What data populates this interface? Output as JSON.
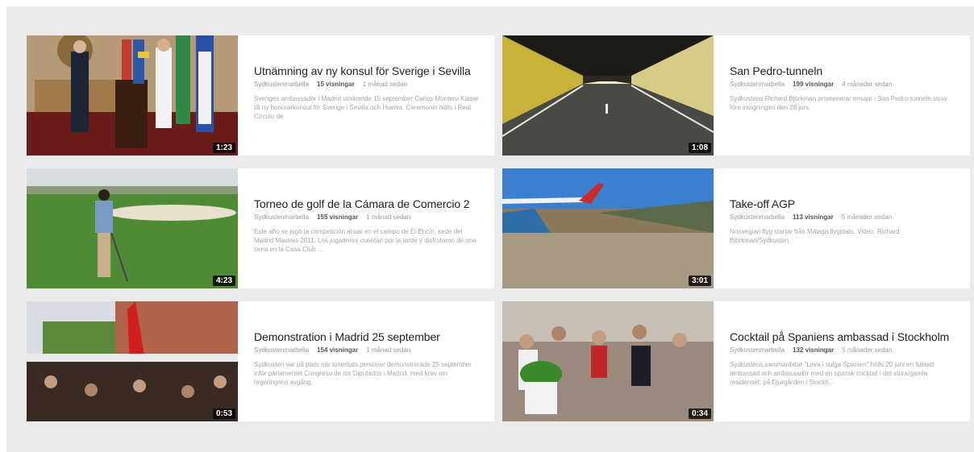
{
  "videos": [
    {
      "title": "Utnämning av ny konsul för Sverige i Sevilla",
      "channel": "Sydkustenmarbella",
      "views": "15 visningar",
      "age": "1 månad sedan",
      "description": "Sveriges ambassadör i Madrid utnämnde 15 september Carlos Montero Kaiser till ny honorärkonsul för Sverige i Sevilla och Huelva. Ceremonin hölls i Real Círculo de",
      "duration": "1:23"
    },
    {
      "title": "San Pedro-tunneln",
      "channel": "Sydkustenmarbella",
      "views": "199 visningar",
      "age": "4 månader sedan",
      "description": "Sydkustens Richard Björkman promenerar ensam i San Pedro-tunneln strax före invigningen den 28 juni.",
      "duration": "1:08"
    },
    {
      "title": "Torneo de golf de la Cámara de Comercio 2",
      "channel": "Sydkustenmarbella",
      "views": "155 visningar",
      "age": "1 månad sedan",
      "description": "Este año se jugó la competición anual en el campo de El Encín, sede del Madrid Masters 2011. Los jugadores cuentan por la tarde y disfrutaron de una cena en la Casa Club ...",
      "duration": "4:23"
    },
    {
      "title": "Take-off AGP",
      "channel": "Sydkustenmarbella",
      "views": "113 visningar",
      "age": "5 månader sedan",
      "description": "Norwegian flyg startar från Málaga flygplats. Video: Richard Björkman/Sydkusten",
      "duration": "3:01"
    },
    {
      "title": "Demonstration i Madrid 25 september",
      "channel": "Sydkustenmarbella",
      "views": "154 visningar",
      "age": "1 månad sedan",
      "description": "Sydkusten var på plats när tusentals personer demonstrerade 25 september inför parlamentet Congreso de los Diputados i Madrid, med krav om regeringens avgång.",
      "duration": "0:53"
    },
    {
      "title": "Cocktail på Spaniens ambassad i Stockholm",
      "channel": "Sydkustenmarbella",
      "views": "132 visningar",
      "age": "5 månader sedan",
      "description": "Sydkustens sammanfatar \"Leva i solga Spanien\" hölls 20 juni en fullsatt ambassad och ambassadör med en spansk cocktail i det stora/gamla residenset, på Djurgården i Stockh...",
      "duration": "0:34"
    }
  ],
  "icons": {
    "thumbnail_subjects": [
      "podium-flags-image",
      "tunnel-image",
      "golf-course-image",
      "airplane-coast-image",
      "protest-crowd-image",
      "cocktail-party-image"
    ]
  }
}
